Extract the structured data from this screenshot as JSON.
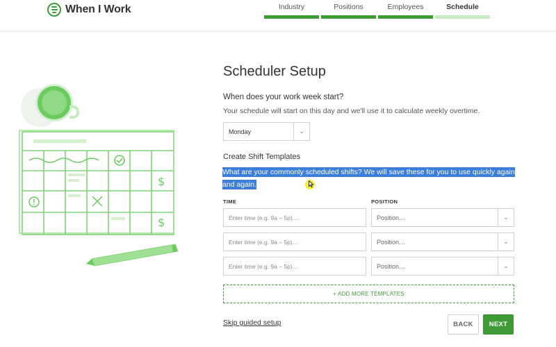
{
  "app": {
    "brand": "When I Work",
    "accent": "#3f9b37",
    "accent_light": "#c5ecc0"
  },
  "steps": [
    {
      "label": "Industry",
      "active": false
    },
    {
      "label": "Positions",
      "active": false
    },
    {
      "label": "Employees",
      "active": false
    },
    {
      "label": "Schedule",
      "active": true
    }
  ],
  "setup": {
    "title": "Scheduler Setup",
    "week_question": "When does your work week start?",
    "week_desc": "Your schedule will start on this day and we'll use it to calculate weekly overtime.",
    "week_start": "Monday",
    "templates_label": "Create Shift Templates",
    "templates_desc": "What are your commonly scheduled shifts? We will save these for you to use quickly again and again.",
    "time_header": "TIME",
    "position_header": "POSITION",
    "rows": [
      {
        "time_placeholder": "Enter time (e.g. 9a – 5p)…",
        "position_placeholder": "Position…"
      },
      {
        "time_placeholder": "Enter time (e.g. 9a – 5p)…",
        "position_placeholder": "Position…"
      },
      {
        "time_placeholder": "Enter time (e.g. 9a – 5p)…",
        "position_placeholder": "Position…"
      }
    ],
    "add_more": "+ ADD MORE TEMPLATES",
    "skip": "Skip guided setup",
    "back": "BACK",
    "next": "NEXT"
  },
  "illustration": {
    "icons": [
      "coffee-cup-icon",
      "calendar-icon",
      "check-icon",
      "dollar-icon",
      "alert-icon",
      "x-icon",
      "pencil-icon"
    ]
  }
}
